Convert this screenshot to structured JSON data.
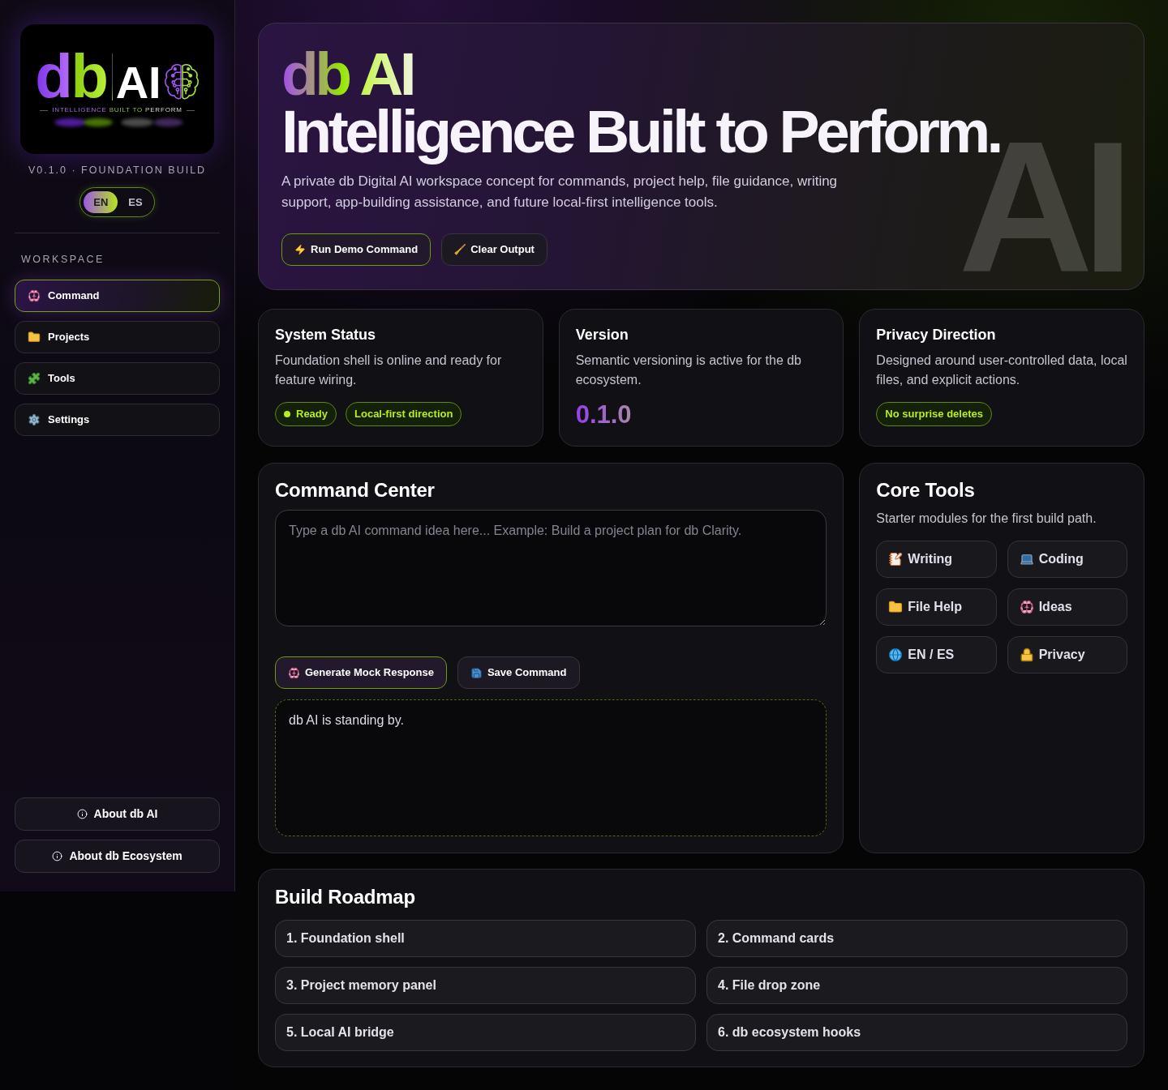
{
  "sidebar": {
    "logo": {
      "letters": "db",
      "wordmark": "AI",
      "tagline": "INTELLIGENCE BUILT TO PERFORM"
    },
    "build_label": "V0.1.0 · FOUNDATION BUILD",
    "languages": [
      {
        "label": "EN",
        "selected": true
      },
      {
        "label": "ES",
        "selected": false
      }
    ],
    "section_label": "WORKSPACE",
    "nav": [
      {
        "label": "Command",
        "selected": true
      },
      {
        "label": "Projects",
        "selected": false
      },
      {
        "label": "Tools",
        "selected": false
      },
      {
        "label": "Settings",
        "selected": false
      }
    ],
    "footer_buttons": [
      "About db AI",
      "About db Ecosystem"
    ]
  },
  "hero": {
    "brand": "db AI",
    "title": "Intelligence Built to Perform.",
    "description": "A private db Digital AI workspace concept for commands, project help, file guidance, writing support, app-building assistance, and future local-first intelligence tools.",
    "buttons": [
      {
        "label": "Run Demo Command",
        "kind": "primary"
      },
      {
        "label": "Clear Output",
        "kind": "secondary"
      }
    ],
    "backdrop_text": "AI"
  },
  "status_cards": [
    {
      "title": "System Status",
      "text": "Foundation shell is online and ready for feature wiring.",
      "badges": [
        {
          "kind": "status",
          "label": "Ready"
        },
        {
          "kind": "tag",
          "label": "Local-first direction"
        }
      ]
    },
    {
      "title": "Version",
      "text": "Semantic versioning is active for the db ecosystem.",
      "version": "0.1.0"
    },
    {
      "title": "Privacy Direction",
      "text": "Designed around user-controlled data, local files, and explicit actions.",
      "badges": [
        {
          "kind": "tag",
          "label": "No surprise deletes"
        }
      ]
    }
  ],
  "command_center": {
    "title": "Command Center",
    "input": {
      "placeholder": "Type a db AI command idea here... Example: Build a project plan for db Clarity."
    },
    "buttons": [
      {
        "label": "Generate Mock Response",
        "kind": "primary"
      },
      {
        "label": "Save Command",
        "kind": "secondary"
      }
    ],
    "output": "db AI is standing by."
  },
  "core_tools": {
    "title": "Core Tools",
    "subtitle": "Starter modules for the first build path.",
    "tools": [
      "Writing",
      "Coding",
      "File Help",
      "Ideas",
      "EN / ES",
      "Privacy"
    ]
  },
  "roadmap": {
    "title": "Build Roadmap",
    "items": [
      "1. Foundation shell",
      "2. Command cards",
      "3. Project memory panel",
      "4. File drop zone",
      "5. Local AI bridge",
      "6. db ecosystem hooks"
    ]
  }
}
